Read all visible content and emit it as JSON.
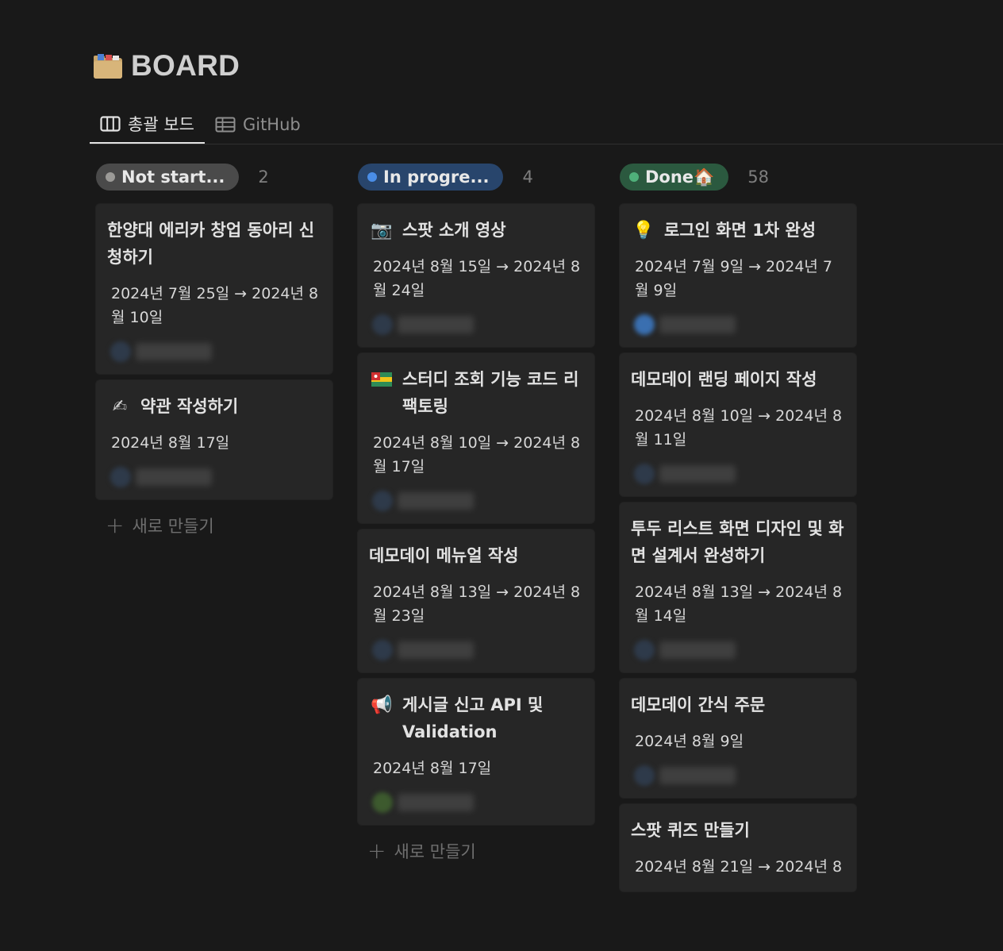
{
  "page": {
    "title": "BOARD",
    "title_icon": "file-cabinet-icon"
  },
  "tabs": [
    {
      "label": "총괄 보드",
      "icon": "board-icon",
      "active": true
    },
    {
      "label": "GitHub",
      "icon": "table-icon",
      "active": false
    }
  ],
  "columns": [
    {
      "label": "Not start...",
      "count": "2",
      "dot_color": "#9b9a97",
      "pill_bg": "#4a4a4a",
      "new_label": "새로 만들기",
      "cards": [
        {
          "icon": "",
          "title": "한양대 에리카 창업 동아리 신청하기",
          "date": "2024년 7월 25일 → 2024년 8월 10일"
        },
        {
          "icon": "writing-hand-icon",
          "glyph": "✍",
          "title": "약관 작성하기",
          "date": "2024년 8월 17일"
        }
      ]
    },
    {
      "label": "In progre...",
      "count": "4",
      "dot_color": "#4a8de6",
      "pill_bg": "#28456c",
      "new_label": "새로 만들기",
      "cards": [
        {
          "icon": "camera-icon",
          "glyph": "📷",
          "title": "스팟 소개 영상",
          "date": "2024년 8월 15일 → 2024년 8월 24일"
        },
        {
          "icon": "flag-icon",
          "glyph": "▤",
          "title": "스터디 조회 기능 코드 리팩토링",
          "date": "2024년 8월 10일 → 2024년 8월 17일"
        },
        {
          "icon": "",
          "title": "데모데이 메뉴얼 작성",
          "date": "2024년 8월 13일 → 2024년 8월 23일"
        },
        {
          "icon": "megaphone-icon",
          "glyph": "📢",
          "title": "게시글 신고 API 및 Validation",
          "date": "2024년 8월 17일"
        }
      ]
    },
    {
      "label": "Done🏠",
      "count": "58",
      "dot_color": "#4fb07a",
      "pill_bg": "#2b593f",
      "cards": [
        {
          "icon": "light-bulb-icon",
          "glyph": "💡",
          "title": "로그인 화면 1차 완성",
          "date": "2024년 7월 9일 → 2024년 7월 9일"
        },
        {
          "icon": "",
          "title": "데모데이 랜딩 페이지 작성",
          "date": "2024년 8월 10일 → 2024년 8월 11일"
        },
        {
          "icon": "",
          "title": "투두 리스트 화면 디자인 및 화면 설계서 완성하기",
          "date": "2024년 8월 13일 → 2024년 8월 14일"
        },
        {
          "icon": "",
          "title": "데모데이 간식 주문",
          "date": "2024년 8월 9일"
        },
        {
          "icon": "",
          "title": "스팟 퀴즈 만들기",
          "date": "2024년 8월 21일 → 2024년 8"
        }
      ]
    }
  ]
}
